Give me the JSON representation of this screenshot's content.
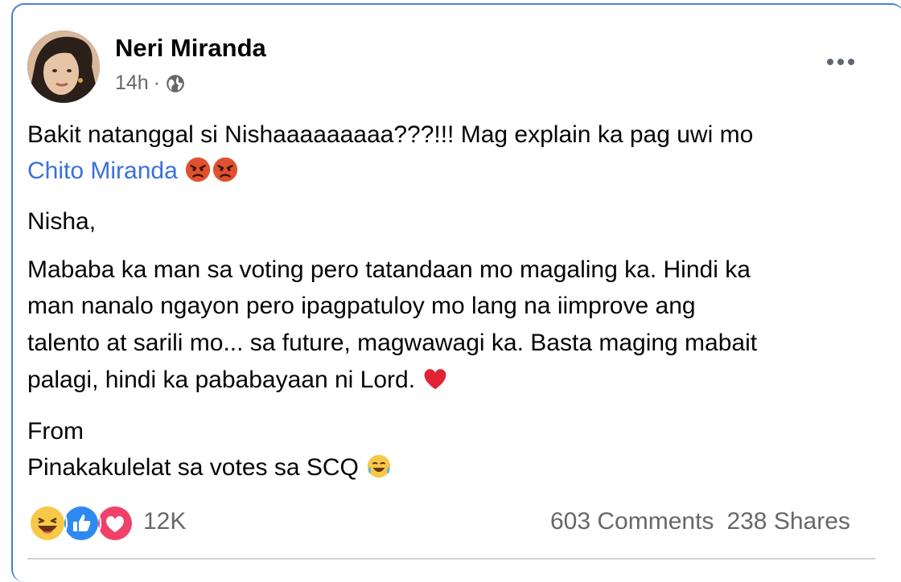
{
  "post": {
    "author": "Neri Miranda",
    "time": "14h",
    "dot": "·",
    "line1": "Bakit natanggal si Nishaaaaaaaaa???!!! Mag explain ka pag uwi mo",
    "mention": "Chito Miranda",
    "line3": "Nisha,",
    "para_lines": [
      "Mababa ka man sa voting pero tatandaan mo magaling ka. Hindi ka",
      "man nanalo ngayon pero ipagpatuloy mo lang na iimprove ang",
      "talento at sarili mo... sa future, magwawagi ka. Basta maging mabait",
      "palagi, hindi ka pababayaan ni Lord."
    ],
    "from": "From",
    "signature": "Pinakakulelat sa votes sa SCQ"
  },
  "footer": {
    "reactions_count": "12K",
    "comments": "603 Comments",
    "shares": "238 Shares"
  },
  "icons": {
    "more": "more-options-icon",
    "globe": "globe-icon",
    "angry": "angry-face-icon",
    "heart": "red-heart-icon",
    "tears": "tears-of-joy-icon"
  },
  "colors": {
    "link": "#3b70d9",
    "muted": "#65676b",
    "card_border": "#4a80d9"
  }
}
